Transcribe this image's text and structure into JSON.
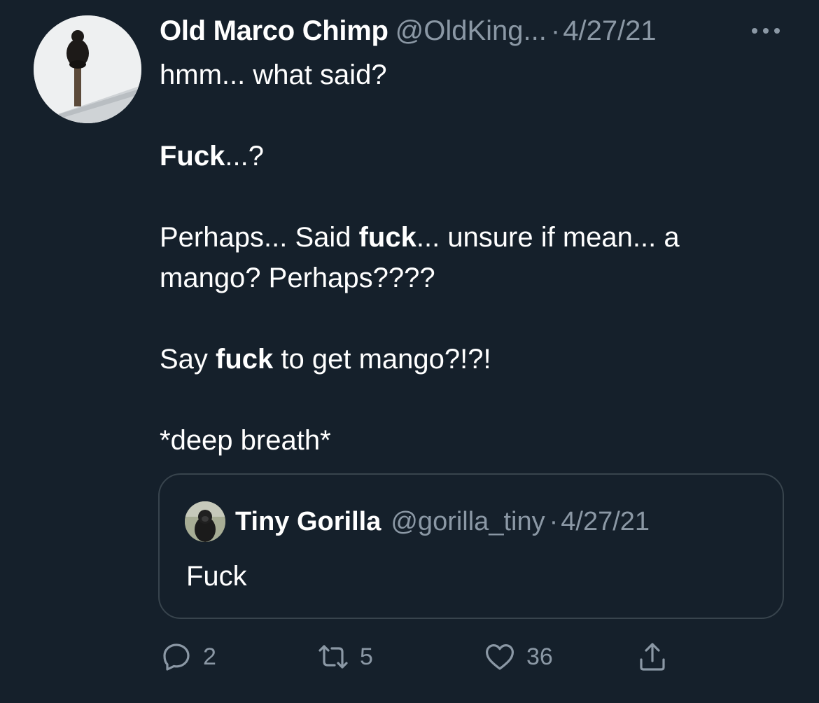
{
  "tweet": {
    "author": {
      "display_name": "Old Marco Chimp",
      "handle": "@OldKing...",
      "avatar_icon": "chimp-on-pole-avatar"
    },
    "separator": "·",
    "timestamp": "4/27/21",
    "more_icon": "more-horizontal-icon",
    "body": {
      "line1": "hmm... what said?",
      "line2_bold": "Fuck",
      "line2_rest": "...?",
      "line3_a": "Perhaps... Said ",
      "line3_bold": "fuck",
      "line3_b": "... unsure if mean... a",
      "line4": "mango? Perhaps????",
      "line5_a": "Say ",
      "line5_bold": "fuck",
      "line5_b": " to get mango?!?!",
      "line6": "*deep breath*"
    },
    "quoted_tweet": {
      "display_name": "Tiny Gorilla",
      "handle": "@gorilla_tiny",
      "separator": "·",
      "timestamp": "4/27/21",
      "text": "Fuck",
      "avatar_icon": "gorilla-avatar"
    },
    "actions": {
      "reply_count": "2",
      "retweet_count": "5",
      "like_count": "36",
      "reply_icon": "reply-icon",
      "retweet_icon": "retweet-icon",
      "like_icon": "heart-icon",
      "share_icon": "share-icon"
    }
  },
  "colors": {
    "background": "#15202b",
    "primary_text": "#ffffff",
    "secondary_text": "#8b98a5",
    "border": "#38444d"
  }
}
